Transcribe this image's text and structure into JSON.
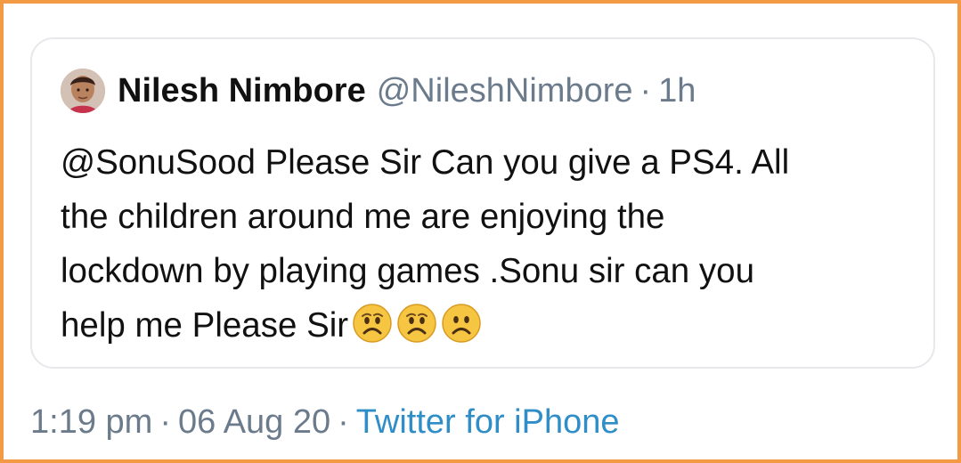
{
  "quoted_tweet": {
    "author": {
      "name": "Nilesh Nimbore",
      "handle": "@NileshNimbore",
      "separator": "·",
      "age": "1h"
    },
    "text": {
      "line1": "@SonuSood Please Sir Can you give a PS4. All",
      "line2": "the children around me are enjoying the",
      "line3": "lockdown by playing games .Sonu sir can you",
      "line4": "help me Please Sir"
    },
    "emojis": [
      "worried-face",
      "worried-face",
      "worried-face"
    ]
  },
  "tweet_meta": {
    "time": "1:19 pm",
    "separator1": "·",
    "date": "06 Aug 20",
    "separator2": "·",
    "source": "Twitter for iPhone"
  },
  "colors": {
    "frame_border": "#f39a45",
    "card_border": "#e6e8eb",
    "text_primary": "#111111",
    "text_secondary": "#6b7b8c",
    "link": "#2f8dc7"
  }
}
